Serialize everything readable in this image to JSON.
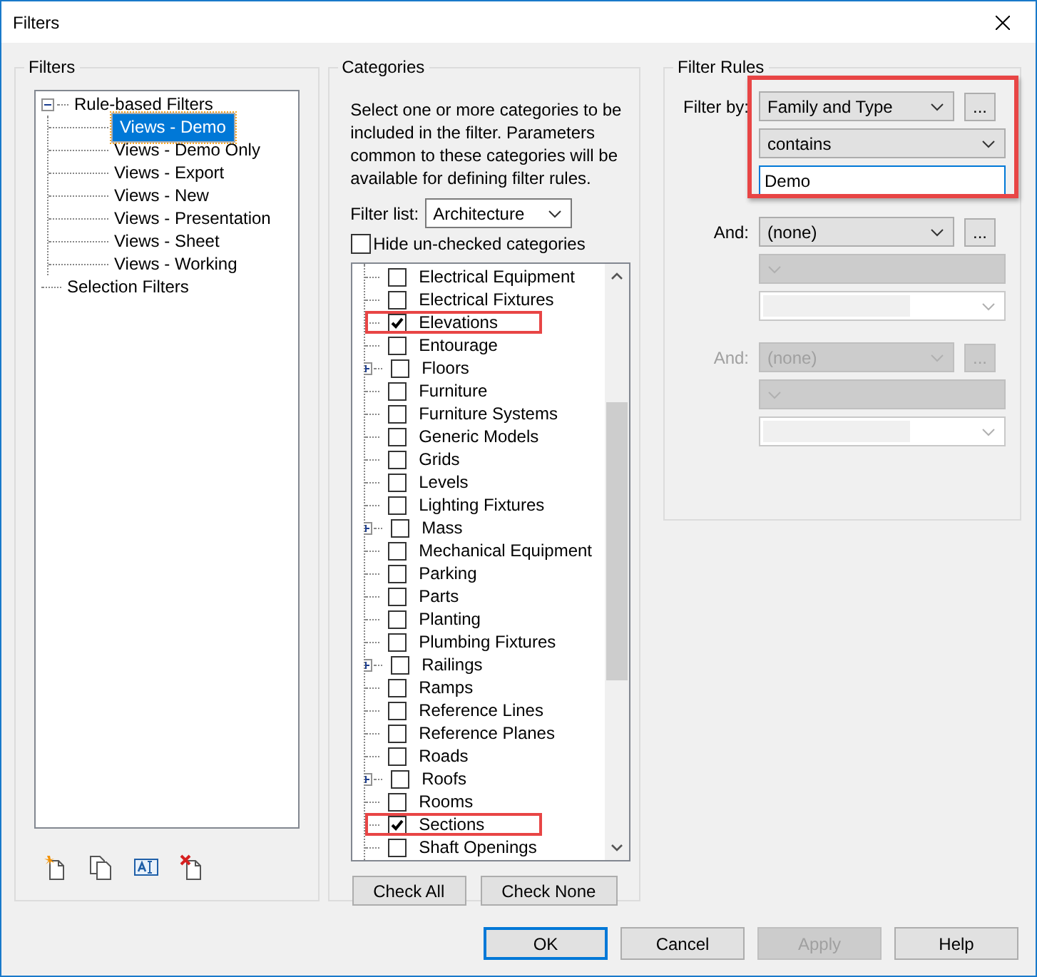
{
  "window": {
    "title": "Filters"
  },
  "filters": {
    "title": "Filters",
    "tree": [
      {
        "label": "Rule-based Filters",
        "expanded": true,
        "selected": false,
        "children": [
          {
            "label": "Views - Demo",
            "selected": true
          },
          {
            "label": "Views - Demo Only",
            "selected": false
          },
          {
            "label": "Views - Export",
            "selected": false
          },
          {
            "label": "Views - New",
            "selected": false
          },
          {
            "label": "Views - Presentation",
            "selected": false
          },
          {
            "label": "Views - Sheet",
            "selected": false
          },
          {
            "label": "Views - Working",
            "selected": false
          }
        ]
      },
      {
        "label": "Selection Filters",
        "selected": false
      }
    ]
  },
  "categories": {
    "title": "Categories",
    "description": "Select one or more categories to be included in the filter.  Parameters common to these categories will be available for defining filter rules.",
    "filter_list": {
      "label": "Filter list:",
      "value": "Architecture"
    },
    "hide_unchecked": {
      "label": "Hide un-checked categories",
      "checked": false
    },
    "items": [
      {
        "label": "Electrical Equipment",
        "checked": false,
        "expandable": false,
        "highlighted": false
      },
      {
        "label": "Electrical Fixtures",
        "checked": false,
        "expandable": false,
        "highlighted": false
      },
      {
        "label": "Elevations",
        "checked": true,
        "expandable": false,
        "highlighted": true
      },
      {
        "label": "Entourage",
        "checked": false,
        "expandable": false,
        "highlighted": false
      },
      {
        "label": "Floors",
        "checked": false,
        "expandable": true,
        "highlighted": false
      },
      {
        "label": "Furniture",
        "checked": false,
        "expandable": false,
        "highlighted": false
      },
      {
        "label": "Furniture Systems",
        "checked": false,
        "expandable": false,
        "highlighted": false
      },
      {
        "label": "Generic Models",
        "checked": false,
        "expandable": false,
        "highlighted": false
      },
      {
        "label": "Grids",
        "checked": false,
        "expandable": false,
        "highlighted": false
      },
      {
        "label": "Levels",
        "checked": false,
        "expandable": false,
        "highlighted": false
      },
      {
        "label": "Lighting Fixtures",
        "checked": false,
        "expandable": false,
        "highlighted": false
      },
      {
        "label": "Mass",
        "checked": false,
        "expandable": true,
        "highlighted": false
      },
      {
        "label": "Mechanical Equipment",
        "checked": false,
        "expandable": false,
        "highlighted": false
      },
      {
        "label": "Parking",
        "checked": false,
        "expandable": false,
        "highlighted": false
      },
      {
        "label": "Parts",
        "checked": false,
        "expandable": false,
        "highlighted": false
      },
      {
        "label": "Planting",
        "checked": false,
        "expandable": false,
        "highlighted": false
      },
      {
        "label": "Plumbing Fixtures",
        "checked": false,
        "expandable": false,
        "highlighted": false
      },
      {
        "label": "Railings",
        "checked": false,
        "expandable": true,
        "highlighted": false
      },
      {
        "label": "Ramps",
        "checked": false,
        "expandable": false,
        "highlighted": false
      },
      {
        "label": "Reference Lines",
        "checked": false,
        "expandable": false,
        "highlighted": false
      },
      {
        "label": "Reference Planes",
        "checked": false,
        "expandable": false,
        "highlighted": false
      },
      {
        "label": "Roads",
        "checked": false,
        "expandable": false,
        "highlighted": false
      },
      {
        "label": "Roofs",
        "checked": false,
        "expandable": true,
        "highlighted": false
      },
      {
        "label": "Rooms",
        "checked": false,
        "expandable": false,
        "highlighted": false
      },
      {
        "label": "Sections",
        "checked": true,
        "expandable": false,
        "highlighted": true
      },
      {
        "label": "Shaft Openings",
        "checked": false,
        "expandable": false,
        "highlighted": false
      }
    ],
    "buttons": [
      "Check All",
      "Check None"
    ]
  },
  "filter_rules": {
    "title": "Filter Rules",
    "rules": [
      {
        "label": "Filter by:",
        "disabled": false,
        "highlighted": true,
        "parameter": "Family and Type",
        "more": "...",
        "operator": "contains",
        "value": "Demo"
      },
      {
        "label": "And:",
        "disabled": false,
        "highlighted": false,
        "parameter": "(none)",
        "more": "..."
      },
      {
        "label": "And:",
        "disabled": true,
        "highlighted": false,
        "parameter": "(none)",
        "more": "..."
      }
    ]
  },
  "buttons": [
    {
      "label": "OK",
      "kind": "default",
      "disabled": false
    },
    {
      "label": "Cancel",
      "kind": "normal",
      "disabled": false
    },
    {
      "label": "Apply",
      "kind": "normal",
      "disabled": true
    },
    {
      "label": "Help",
      "kind": "normal",
      "disabled": false
    }
  ]
}
